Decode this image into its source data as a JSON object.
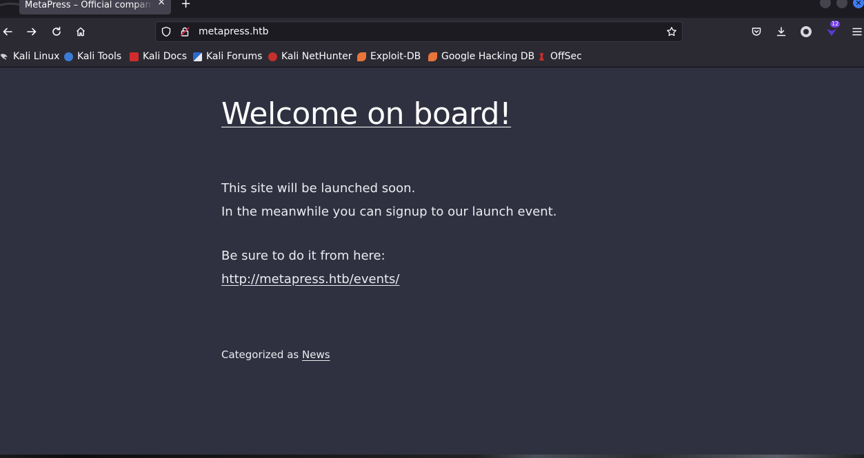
{
  "tab": {
    "title": "MetaPress – Official company site",
    "close_glyph": "×",
    "new_tab_glyph": "+"
  },
  "window_controls": {
    "close_glyph": "✕"
  },
  "toolbar": {
    "url": "metapress.htb",
    "extension_badge": "12"
  },
  "bookmarks": [
    {
      "label": "Kali Linux",
      "icon": "kali-dragon-icon",
      "color": "#d0d0d8"
    },
    {
      "label": "Kali Tools",
      "icon": "kali-tools-icon",
      "color": "#3a7bd5"
    },
    {
      "label": "Kali Docs",
      "icon": "kali-docs-icon",
      "color": "#d22b2b"
    },
    {
      "label": "Kali Forums",
      "icon": "kali-forums-icon",
      "color": "#2a6ad0"
    },
    {
      "label": "Kali NetHunter",
      "icon": "nethunter-icon",
      "color": "#c4302b"
    },
    {
      "label": "Exploit-DB",
      "icon": "exploit-db-icon",
      "color": "#e8763a"
    },
    {
      "label": "Google Hacking DB",
      "icon": "ghdb-icon",
      "color": "#e8763a"
    },
    {
      "label": "OffSec",
      "icon": "offsec-icon",
      "color": "#c4302b"
    }
  ],
  "page": {
    "headline": "Welcome on board!",
    "line1": "This site will be launched soon.",
    "line2": "In the meanwhile you can signup to our launch event.",
    "line3": "Be sure to do it from here:",
    "events_link": "http://metapress.htb/events/",
    "category_prefix": "Categorized as",
    "category_link": "News"
  }
}
